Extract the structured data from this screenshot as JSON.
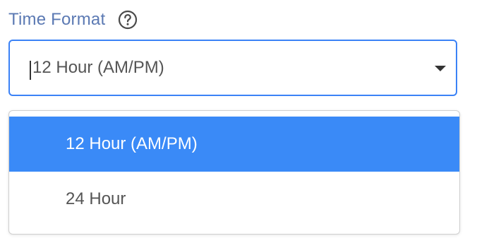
{
  "field": {
    "label": "Time Format",
    "help_icon": "question-circle-icon"
  },
  "select": {
    "value": "12 Hour (AM/PM)",
    "arrow_icon": "triangle-down-icon"
  },
  "options": [
    {
      "label": "12 Hour (AM/PM)",
      "selected": true
    },
    {
      "label": "24 Hour",
      "selected": false
    }
  ],
  "colors": {
    "label": "#5b79b3",
    "focus_border": "#3b82f6",
    "selected_option_bg": "#3a8af7",
    "option_text": "#555555"
  }
}
